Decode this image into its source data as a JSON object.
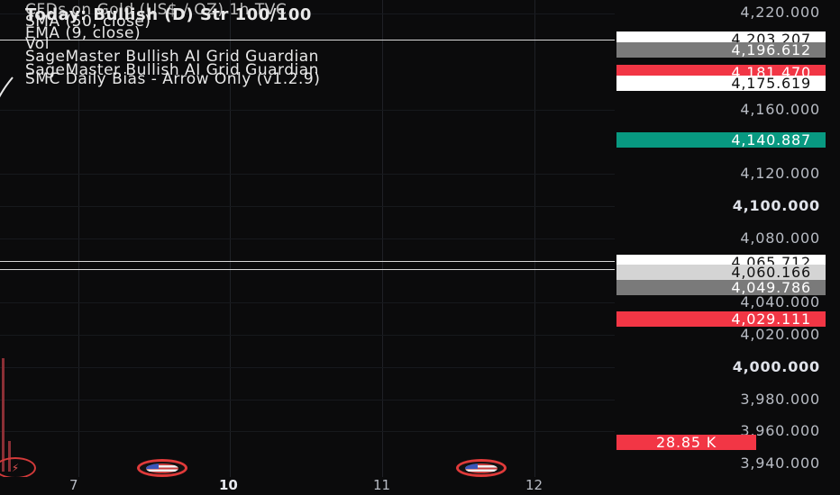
{
  "legend": {
    "symbol_line": "CFDs on Gold (US$ / OZ) 1h  TVC",
    "bias_line": "Today: Bullish (D)  Str 100/100",
    "sma": "SMA (50, close)",
    "ema": "EMA (9, close)",
    "vol": "Vol",
    "indicator_1": "SageMaster Bullish AI Grid Guardian",
    "indicator_2": "SageMaster Bullish AI Grid Guardian",
    "indicator_3": "SMC Daily Bias - Arrow Only (v1.2.9)"
  },
  "price_axis": {
    "ticks": [
      "4,220.000",
      "4,160.000",
      "4,120.000",
      "4,100.000",
      "4,080.000",
      "4,040.000",
      "4,020.000",
      "4,000.000",
      "3,980.000",
      "3,960.000",
      "3,940.000"
    ],
    "labels": {
      "l1": "4,203.207",
      "l2": "4,196.612",
      "l3": "4,181.470",
      "l4": "4,175.619",
      "l5": "4,140.887",
      "l6": "4,065.712",
      "l7": "4,060.166",
      "l8": "4,049.786",
      "l9": "4,029.111",
      "volume": "28.85 K"
    }
  },
  "time_axis": {
    "labels": [
      "7",
      "10",
      "11",
      "12"
    ]
  },
  "colors": {
    "background": "#0b0b0c",
    "red": "#f23645",
    "green": "#089981",
    "grey": "#7a7a7a"
  },
  "icons": {
    "arrow": "check-arrow-icon",
    "flag": "us-flag-icon",
    "bias": "bias-marker-icon"
  }
}
